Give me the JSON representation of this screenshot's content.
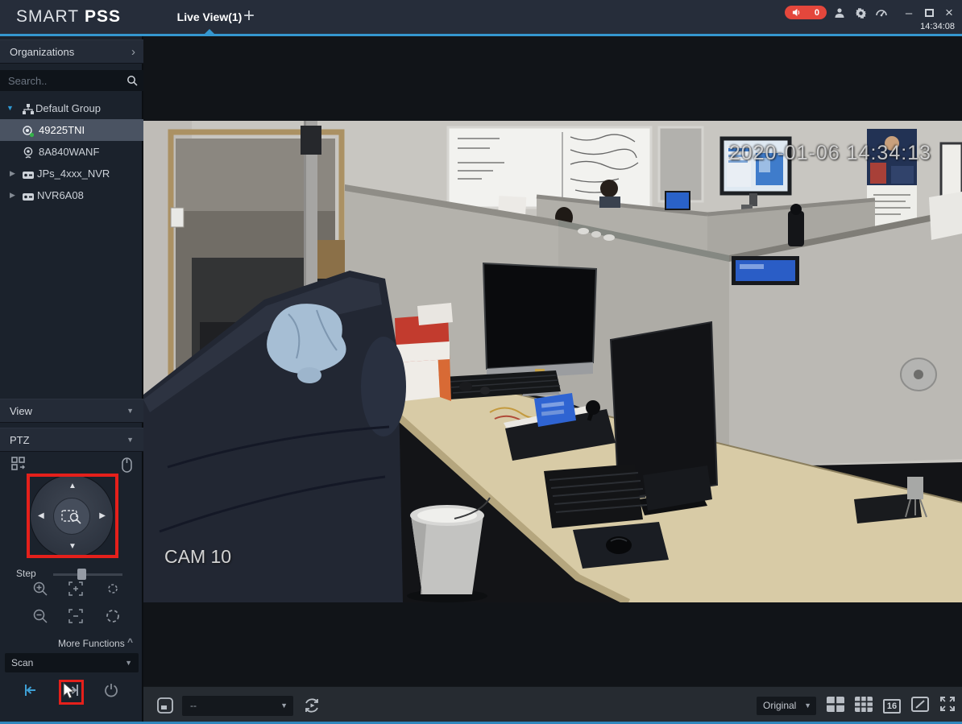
{
  "window": {
    "brand_smart": "SMART",
    "brand_pss": "PSS",
    "time": "14:34:08",
    "alert_count": "0",
    "minimize_glyph": "–",
    "close_glyph": "×"
  },
  "tabs": {
    "live_view": "Live View(1)",
    "add_glyph": "+"
  },
  "sidebar": {
    "organizations": {
      "label": "Organizations",
      "chevron": "›"
    },
    "search": {
      "placeholder": "Search.."
    },
    "tree": [
      {
        "label": "Default Group",
        "type": "group",
        "expanded": true
      },
      {
        "label": "49225TNI",
        "type": "camera",
        "selected": true
      },
      {
        "label": "8A840WANF",
        "type": "camera",
        "selected": false
      },
      {
        "label": "JPs_4xxx_NVR",
        "type": "nvr",
        "selected": false
      },
      {
        "label": "NVR6A08",
        "type": "nvr",
        "selected": false
      }
    ],
    "view": {
      "label": "View",
      "chevron": "▼"
    },
    "ptz": {
      "label": "PTZ",
      "chevron": "▼",
      "step_label": "Step",
      "more_functions": "More Functions",
      "more_chevron": "^",
      "scan": {
        "label": "Scan",
        "chevron": "▼"
      }
    }
  },
  "video": {
    "timestamp": "2020-01-06 14:34:13",
    "camera_label": "CAM 10"
  },
  "toolbar": {
    "stream_value": "--",
    "stream_chevron": "▼",
    "scale_value": "Original",
    "scale_chevron": "▼",
    "grid16": "16"
  },
  "glyphs": {
    "expand_open": "▼",
    "expand_closed": "▶",
    "up": "▲",
    "down": "▼",
    "left": "◀",
    "right": "▶"
  },
  "colors": {
    "accent_blue": "#3597cf",
    "alert_red": "#e4473c",
    "annotation_red": "#e5201b",
    "selected_row": "#4a5362"
  }
}
